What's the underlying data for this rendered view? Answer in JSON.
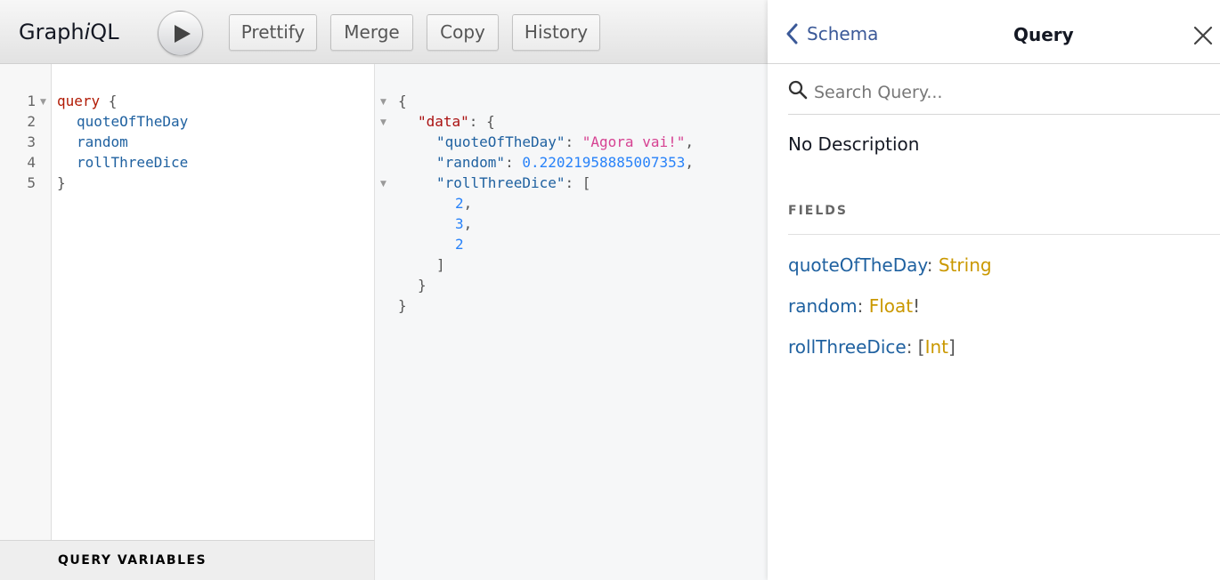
{
  "toolbar": {
    "brand_prefix": "Graph",
    "brand_italic": "i",
    "brand_suffix": "QL",
    "prettify_label": "Prettify",
    "merge_label": "Merge",
    "copy_label": "Copy",
    "history_label": "History"
  },
  "query_editor": {
    "line_numbers": [
      "1",
      "2",
      "3",
      "4",
      "5"
    ],
    "lines": [
      {
        "keyword": "query",
        "punct": " {"
      },
      {
        "field": "quoteOfTheDay"
      },
      {
        "field": "random"
      },
      {
        "field": "rollThreeDice"
      },
      {
        "punct": "}"
      }
    ]
  },
  "variables": {
    "label": "QUERY VARIABLES"
  },
  "result": {
    "open_brace": "{",
    "data_key": "\"data\"",
    "quote_key": "\"quoteOfTheDay\"",
    "quote_value": "\"Agora vai!\"",
    "random_key": "\"random\"",
    "random_value": "0.22021958885007353",
    "dice_key": "\"rollThreeDice\"",
    "dice_values": [
      "2",
      "3",
      "2"
    ]
  },
  "docs": {
    "back_label": "Schema",
    "title": "Query",
    "search_placeholder": "Search Query...",
    "description": "No Description",
    "fields_title": "FIELDS",
    "fields": [
      {
        "name": "quoteOfTheDay",
        "type": "String",
        "prefix": "",
        "suffix": ""
      },
      {
        "name": "random",
        "type": "Float",
        "prefix": "",
        "suffix": "!"
      },
      {
        "name": "rollThreeDice",
        "type": "Int",
        "prefix": "[",
        "suffix": "]"
      }
    ]
  },
  "colors": {
    "keyword": "#b11a04",
    "field": "#1f61a0",
    "string": "#d64292",
    "number": "#2882f9",
    "type": "#ca9800",
    "link": "#3b5998"
  },
  "icons": {
    "run": "play-icon",
    "back": "chevron-left-icon",
    "close": "close-icon",
    "search": "search-icon"
  }
}
